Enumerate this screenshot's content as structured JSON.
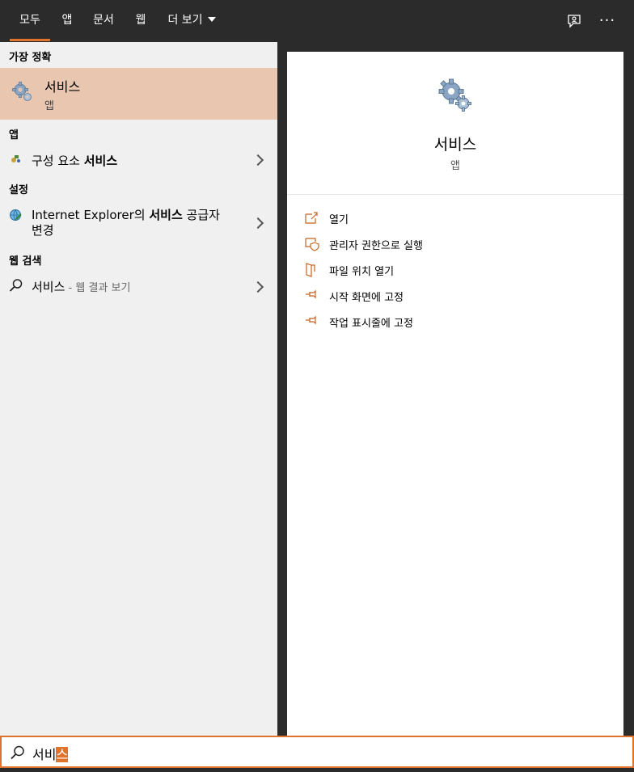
{
  "tabs": [
    {
      "label": "모두",
      "active": true
    },
    {
      "label": "앱"
    },
    {
      "label": "문서"
    },
    {
      "label": "웹"
    },
    {
      "label": "더 보기"
    }
  ],
  "topbar_icons": [
    "feedback-icon",
    "more-options-icon"
  ],
  "more_glyph": "···",
  "left": {
    "best_match": {
      "heading": "가장 정확",
      "title": "서비스",
      "subtitle": "앱",
      "icon": "gears-icon"
    },
    "apps": {
      "heading": "앱",
      "item": {
        "prefix": "구성 요소 ",
        "bold": "서비스",
        "suffix": "",
        "icon": "component-services-icon"
      }
    },
    "settings": {
      "heading": "설정",
      "item": {
        "prefix": "Internet Explorer의 ",
        "bold": "서비스",
        "suffix": " 공급자",
        "line2": "변경",
        "icon": "internet-options-icon"
      }
    },
    "web": {
      "heading": "웹 검색",
      "item": {
        "query": "서비스",
        "suffix": " - 웹 결과 보기",
        "icon": "search-icon"
      }
    }
  },
  "right": {
    "title": "서비스",
    "subtitle": "앱",
    "actions": [
      {
        "label": "열기",
        "icon": "open-icon"
      },
      {
        "label": "관리자 권한으로 실행",
        "icon": "run-as-admin-icon"
      },
      {
        "label": "파일 위치 열기",
        "icon": "file-location-icon"
      },
      {
        "label": "시작 화면에 고정",
        "icon": "pin-icon"
      },
      {
        "label": "작업 표시줄에 고정",
        "icon": "pin-taskbar-icon"
      }
    ]
  },
  "search": {
    "typed": "서비",
    "selected": "스"
  },
  "colors": {
    "accent": "#e0742d",
    "topbar": "#2b2b2b",
    "best_match_bg": "#e8c6b0",
    "left_bg": "#f0f0f0"
  }
}
